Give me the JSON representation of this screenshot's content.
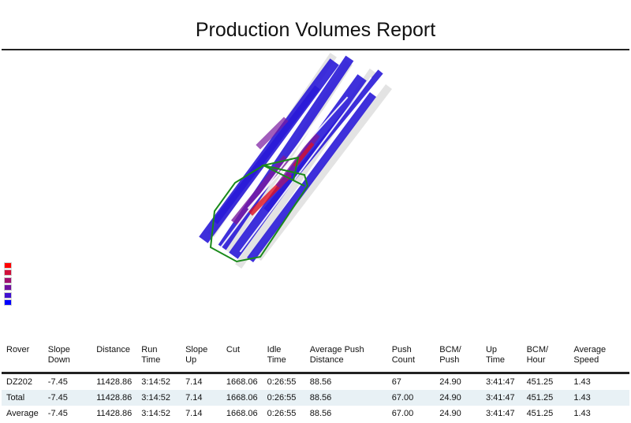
{
  "title": "Production Volumes Report",
  "legend_colors": [
    "#ff0000",
    "#d0103a",
    "#a01070",
    "#7010a0",
    "#4010d0",
    "#0000ff"
  ],
  "heatmap_colors": {
    "low": "#2a1ad8",
    "mid": "#7a1aa0",
    "high": "#e01020",
    "sparse": "#c8c8c8",
    "boundary": "#1a8a1a"
  },
  "table": {
    "headers": [
      "Rover",
      "Slope Down",
      "Distance",
      "Run Time",
      "Slope Up",
      "Cut",
      "Idle Time",
      "Average Push Distance",
      "Push Count",
      "BCM/ Push",
      "Up Time",
      "BCM/ Hour",
      "Average Speed"
    ],
    "rows": [
      [
        "DZ202",
        "-7.45",
        "11428.86",
        "3:14:52",
        "7.14",
        "1668.06",
        "0:26:55",
        "88.56",
        "67",
        "24.90",
        "3:41:47",
        "451.25",
        "1.43"
      ],
      [
        "Total",
        "-7.45",
        "11428.86",
        "3:14:52",
        "7.14",
        "1668.06",
        "0:26:55",
        "88.56",
        "67.00",
        "24.90",
        "3:41:47",
        "451.25",
        "1.43"
      ],
      [
        "Average",
        "-7.45",
        "11428.86",
        "3:14:52",
        "7.14",
        "1668.06",
        "0:26:55",
        "88.56",
        "67.00",
        "24.90",
        "3:41:47",
        "451.25",
        "1.43"
      ]
    ]
  }
}
